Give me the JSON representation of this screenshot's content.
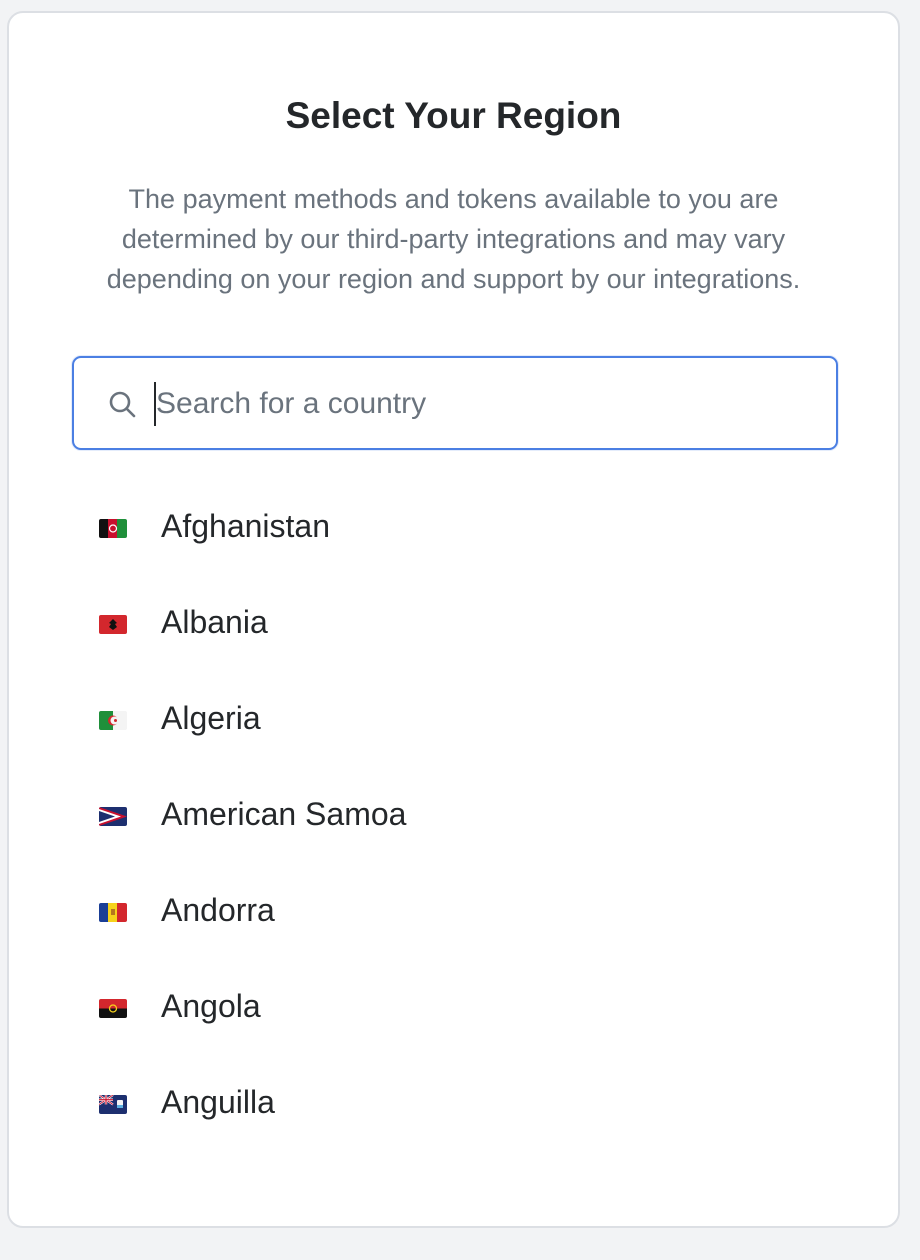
{
  "dialog": {
    "title": "Select Your Region",
    "description": "The payment methods and tokens available to you are determined by our third-party integrations and may vary depending on your region and support by our integrations."
  },
  "search": {
    "placeholder": "Search for a country",
    "value": "",
    "icon": "search-icon"
  },
  "countries": [
    {
      "name": "Afghanistan",
      "flag": "flag-afghanistan-icon"
    },
    {
      "name": "Albania",
      "flag": "flag-albania-icon"
    },
    {
      "name": "Algeria",
      "flag": "flag-algeria-icon"
    },
    {
      "name": "American Samoa",
      "flag": "flag-american-samoa-icon"
    },
    {
      "name": "Andorra",
      "flag": "flag-andorra-icon"
    },
    {
      "name": "Angola",
      "flag": "flag-angola-icon"
    },
    {
      "name": "Anguilla",
      "flag": "flag-anguilla-icon"
    }
  ],
  "colors": {
    "accent": "#4b7fe3",
    "text": "#24272a",
    "muted": "#6a737d",
    "border": "#dcdfe4"
  }
}
